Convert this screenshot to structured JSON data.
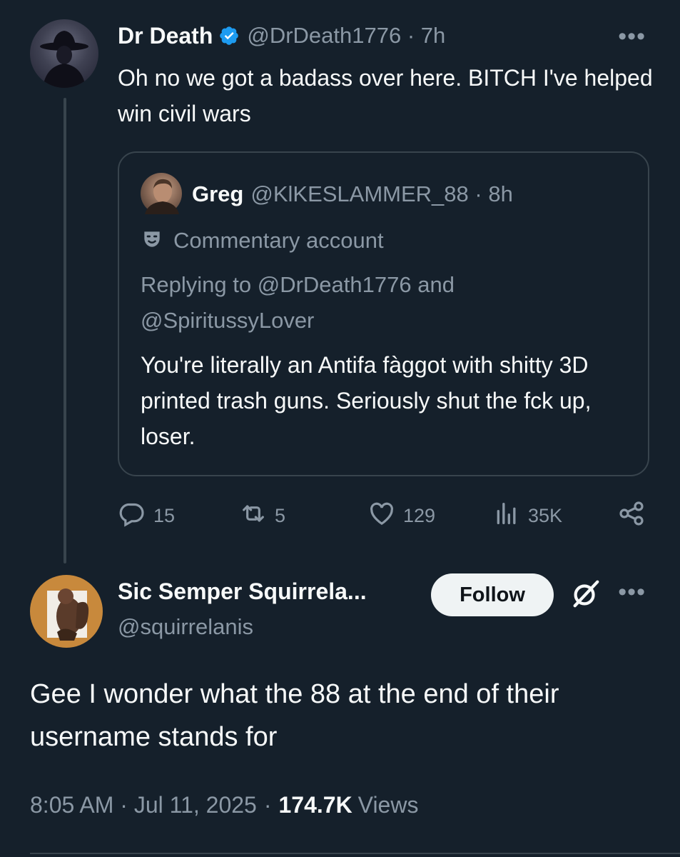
{
  "reply_tweet": {
    "author_name": "Dr Death",
    "handle": "@DrDeath1776",
    "time": "7h",
    "text": "Oh no we got a badass over here. BITCH I've helped win civil wars",
    "quoted_tweet": {
      "author_name": "Greg",
      "handle": "@KlKESLAMMER_88",
      "time": "8h",
      "label": "Commentary account",
      "replying_prefix": "Replying to",
      "replying_mention_1": "@DrDeath1776",
      "replying_and": "and",
      "replying_mention_2": "@SpiritussyLover",
      "text": "You're literally an Antifa fàggot with shitty 3D printed trash guns. Seriously shut the fck up, loser."
    },
    "stats": {
      "replies": "15",
      "reposts": "5",
      "likes": "129",
      "views": "35K"
    }
  },
  "main_tweet": {
    "author_name": "Sic Semper Squirrela...",
    "handle": "@squirrelanis",
    "follow_label": "Follow",
    "text": "Gee I wonder what the 88 at the end of their username stands for",
    "timestamp": "8:05 AM · Jul 11, 2025",
    "views_count": "174.7K",
    "views_label": "Views"
  },
  "icons": {
    "verified": "verified-badge-icon",
    "more": "more-icon",
    "commentary": "mask-icon",
    "reply": "reply-icon",
    "repost": "repost-icon",
    "like": "heart-icon",
    "views": "views-icon",
    "share": "share-icon",
    "grok": "grok-icon"
  },
  "colors": {
    "background": "#15202b",
    "text_primary": "#f7f9f9",
    "text_secondary": "#8b98a5",
    "border": "#38444d",
    "verified_blue": "#1d9bf0",
    "follow_bg": "#eff3f4"
  }
}
